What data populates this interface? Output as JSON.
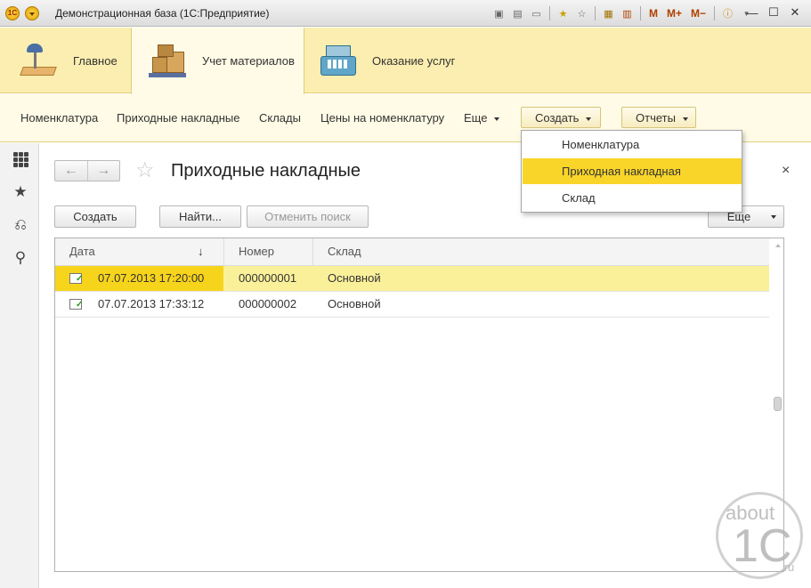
{
  "window": {
    "title": "Демонстрационная база  (1С:Предприятие)",
    "logo_text": "1С",
    "toolbar_m_labels": [
      "M",
      "M+",
      "M−"
    ],
    "icons": [
      "save-icon",
      "print-icon",
      "preview-icon",
      "favorites-add-icon",
      "favorites-icon",
      "calculator-icon",
      "calendar-icon",
      "memory-icon",
      "info-icon"
    ],
    "controls": [
      "minimize-icon",
      "maximize-icon",
      "close-icon"
    ]
  },
  "sections": [
    {
      "label": "Главное",
      "icon": "desk-lamp-icon",
      "active": false
    },
    {
      "label": "Учет материалов",
      "icon": "boxes-cart-icon",
      "active": true
    },
    {
      "label": "Оказание услуг",
      "icon": "cash-register-icon",
      "active": false
    }
  ],
  "functions": {
    "links": [
      "Номенклатура",
      "Приходные накладные",
      "Склады",
      "Цены на номенклатуру"
    ],
    "more": "Еще",
    "create": "Создать",
    "reports": "Отчеты"
  },
  "create_menu": {
    "items": [
      "Номенклатура",
      "Приходная накладная",
      "Склад"
    ],
    "highlighted_index": 1
  },
  "leftbar": {
    "icons": [
      "apps-grid-icon",
      "favorites-star-icon",
      "history-icon",
      "search-icon"
    ]
  },
  "form": {
    "title": "Приходные накладные",
    "back": "←",
    "forward": "→",
    "star": "☆",
    "close": "×",
    "buttons": {
      "create": "Создать",
      "find": "Найти...",
      "cancel_search": "Отменить поиск",
      "more": "Еще"
    }
  },
  "table": {
    "columns": [
      "Дата",
      "Номер",
      "Склад"
    ],
    "sort_indicator": "↓",
    "rows": [
      {
        "date": "07.07.2013 17:20:00",
        "number": "000000001",
        "warehouse": "Основной",
        "selected": true
      },
      {
        "date": "07.07.2013 17:33:12",
        "number": "000000002",
        "warehouse": "Основной",
        "selected": false
      }
    ]
  },
  "watermark": {
    "line1": "about",
    "line2": "1C",
    "line3": ".ru"
  },
  "colors": {
    "section_bg": "#fbeeb0",
    "functions_bg": "#fffbe6",
    "selection_row": "#fbf09a",
    "selection_accent": "#f7d41c",
    "menu_highlight": "#f9d52a"
  }
}
